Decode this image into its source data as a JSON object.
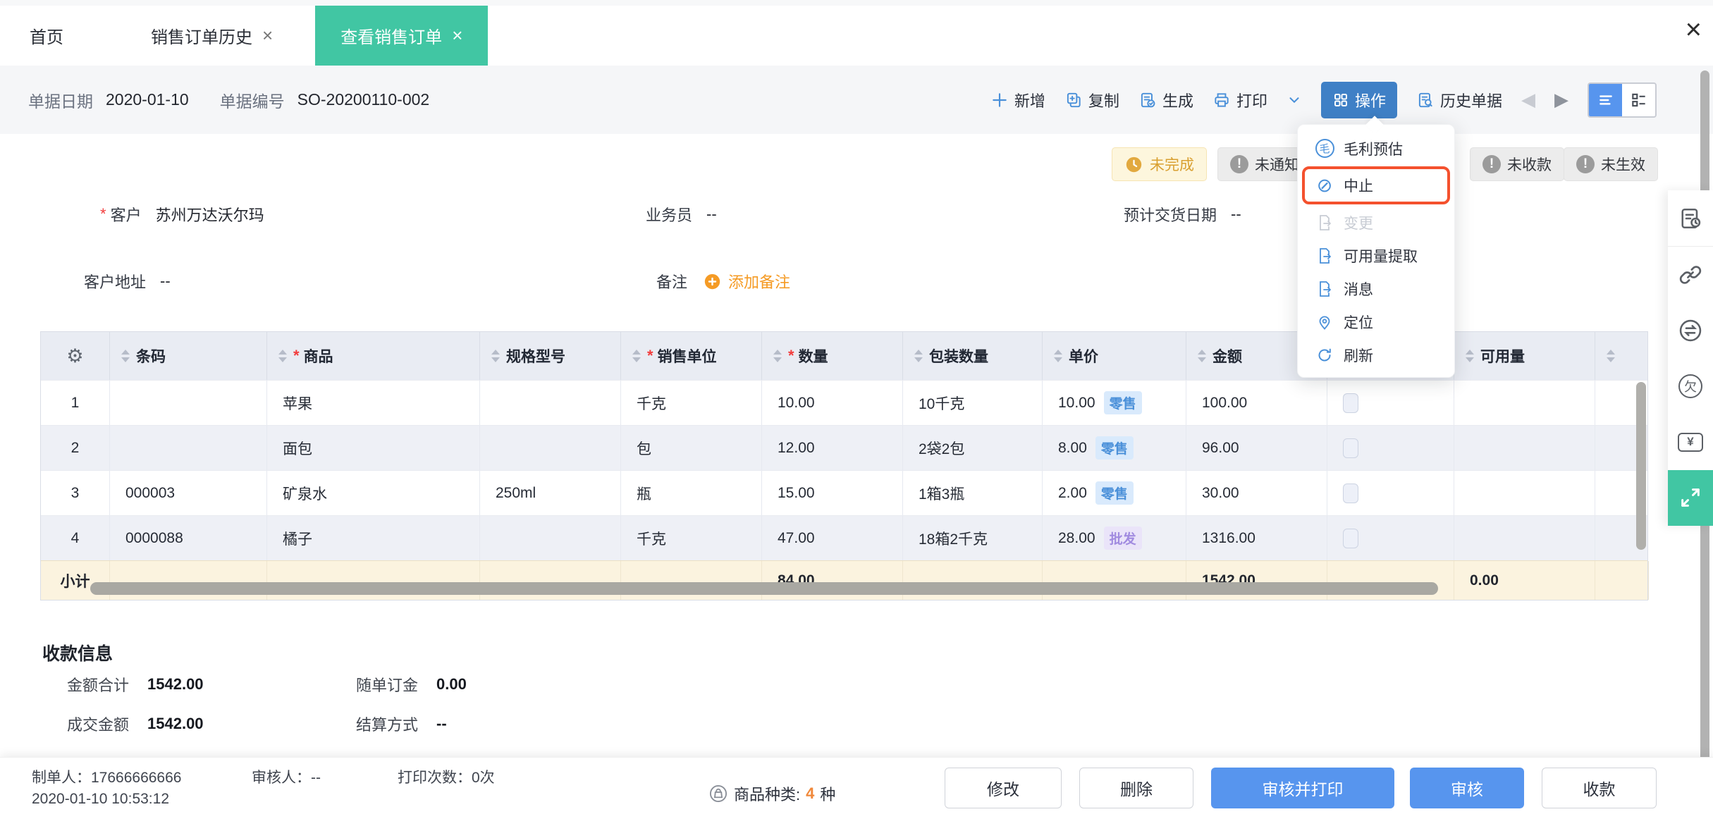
{
  "tabbar": {
    "tabs": [
      {
        "label": "首页",
        "closable": false,
        "active": false
      },
      {
        "label": "销售订单历史",
        "closable": true,
        "active": false
      },
      {
        "label": "查看销售订单",
        "closable": true,
        "active": true
      }
    ],
    "close_glyph": "×",
    "window_close_glyph": "×"
  },
  "toolbar": {
    "doc_date_label": "单据日期",
    "doc_date": "2020-01-10",
    "doc_no_label": "单据编号",
    "doc_no": "SO-20200110-002",
    "new_label": "新增",
    "copy_label": "复制",
    "generate_label": "生成",
    "print_label": "打印",
    "action_label": "操作",
    "history_label": "历史单据"
  },
  "status_badges": [
    {
      "label": "未完成",
      "type": "warning"
    },
    {
      "label": "未通知",
      "type": "default"
    },
    {
      "label": "未收款",
      "type": "default"
    },
    {
      "label": "未生效",
      "type": "default"
    }
  ],
  "action_menu": {
    "items": [
      {
        "label": "毛利预估",
        "glyph": "毛"
      },
      {
        "label": "中止",
        "glyph": "⊘",
        "highlighted": true
      },
      {
        "label": "变更",
        "disabled": true
      },
      {
        "label": "可用量提取"
      },
      {
        "label": "消息"
      },
      {
        "label": "定位"
      },
      {
        "label": "刷新"
      }
    ]
  },
  "form": {
    "required_marker": "*",
    "customer_label": "客户",
    "customer_value": "苏州万达沃尔玛",
    "salesman_label": "业务员",
    "salesman_value": "--",
    "delivery_date_label": "预计交货日期",
    "delivery_date_value": "--",
    "address_label": "客户地址",
    "address_value": "--",
    "remark_label": "备注",
    "add_remark_label": "添加备注"
  },
  "table": {
    "required_marker": "*",
    "columns": [
      {
        "label": "条码"
      },
      {
        "label": "商品",
        "required": true
      },
      {
        "label": "规格型号"
      },
      {
        "label": "销售单位",
        "required": true
      },
      {
        "label": "数量",
        "required": true
      },
      {
        "label": "包装数量"
      },
      {
        "label": "单价"
      },
      {
        "label": "金额"
      },
      {
        "label": ""
      },
      {
        "label": "可用量"
      },
      {
        "label": ""
      }
    ],
    "rows": [
      {
        "num": "1",
        "barcode": "",
        "product": "苹果",
        "spec": "",
        "unit": "千克",
        "qty": "10.00",
        "pack_qty": "10千克",
        "price": "10.00",
        "price_tag": "零售",
        "amount": "100.00",
        "available": ""
      },
      {
        "num": "2",
        "barcode": "",
        "product": "面包",
        "spec": "",
        "unit": "包",
        "qty": "12.00",
        "pack_qty": "2袋2包",
        "price": "8.00",
        "price_tag": "零售",
        "amount": "96.00",
        "available": ""
      },
      {
        "num": "3",
        "barcode": "000003",
        "product": "矿泉水",
        "spec": "250ml",
        "unit": "瓶",
        "qty": "15.00",
        "pack_qty": "1箱3瓶",
        "price": "2.00",
        "price_tag": "零售",
        "amount": "30.00",
        "available": ""
      },
      {
        "num": "4",
        "barcode": "0000088",
        "product": "橘子",
        "spec": "",
        "unit": "千克",
        "qty": "47.00",
        "pack_qty": "18箱2千克",
        "price": "28.00",
        "price_tag": "批发",
        "amount": "1316.00",
        "available": ""
      }
    ],
    "subtotal": {
      "label": "小计",
      "qty": "84.00",
      "amount": "1542.00",
      "available": "0.00"
    }
  },
  "payment": {
    "title": "收款信息",
    "amount_total_label": "金额合计",
    "amount_total": "1542.00",
    "deposit_label": "随单订金",
    "deposit": "0.00",
    "deal_amount_label": "成交金额",
    "deal_amount": "1542.00",
    "settlement_label": "结算方式",
    "settlement": "--"
  },
  "footer": {
    "creator_label": "制单人：",
    "creator": "17666666666",
    "created_time": "2020-01-10 10:53:12",
    "auditor_label": "审核人：",
    "auditor": "--",
    "print_count_label": "打印次数：",
    "print_count": "0次",
    "category_label": "商品种类:",
    "category_count": "4",
    "category_unit": "种",
    "modify_label": "修改",
    "delete_label": "删除",
    "audit_print_label": "审核并打印",
    "audit_label": "审核",
    "receive_label": "收款"
  },
  "colors": {
    "accent_teal": "#41c6a3",
    "accent_blue": "#4a90d9",
    "action_button_blue": "#3f80c6",
    "primary_button_blue": "#5795ee",
    "highlight_red": "#f4512e",
    "warning_orange": "#d9a031",
    "link_orange": "#f59b25"
  }
}
